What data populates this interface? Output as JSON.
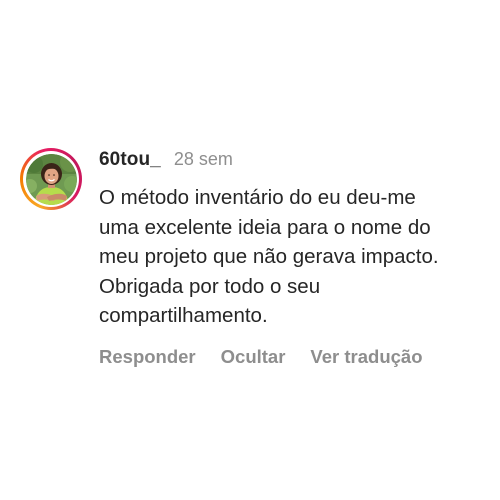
{
  "comment": {
    "username": "60tou_",
    "time_ago": "28 sem",
    "text": "O método inventário do eu deu-me\numa excelente ideia para o nome do\nmeu projeto que não gerava impacto.\nObrigada por todo o seu\ncompartilhamento.",
    "avatar_icon": "profile-photo",
    "story_ring_colors": [
      "#f9a825",
      "#f57c00",
      "#e91e63",
      "#c2185b"
    ]
  },
  "actions": {
    "reply_label": "Responder",
    "hide_label": "Ocultar",
    "translate_label": "Ver tradução"
  },
  "colors": {
    "text_primary": "#262626",
    "text_secondary": "#8e8e8e",
    "background": "#ffffff"
  }
}
